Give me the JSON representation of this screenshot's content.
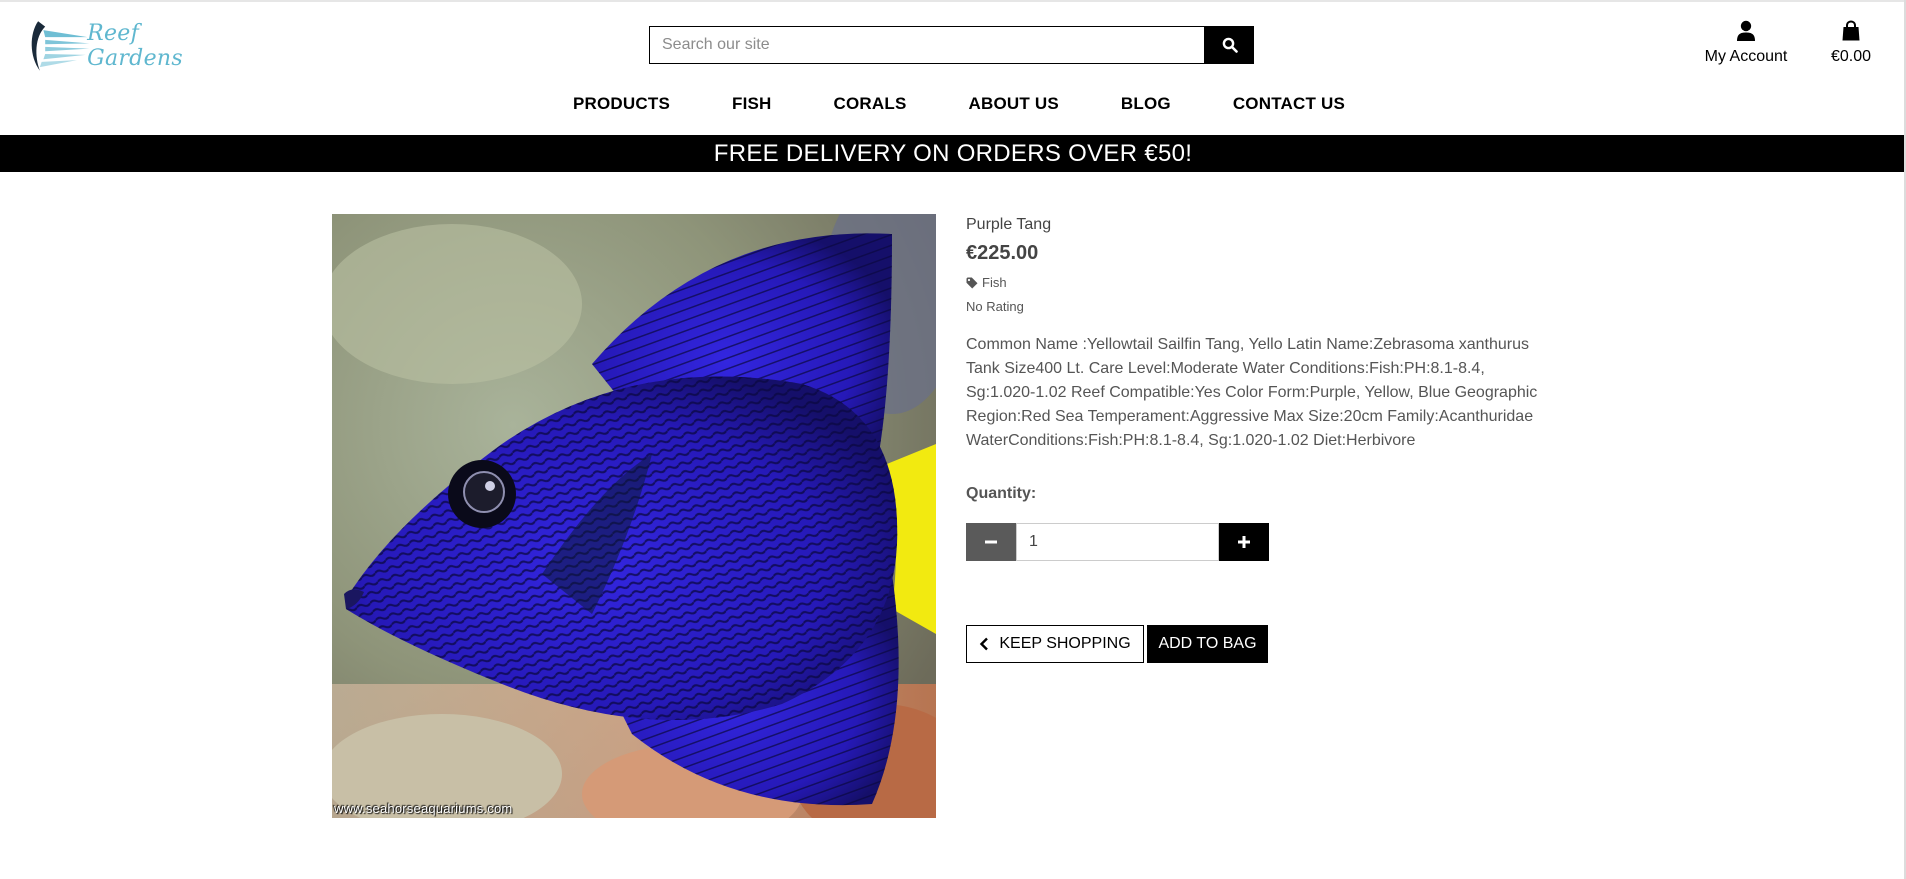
{
  "header": {
    "logo_text": "Reef Gardens",
    "search": {
      "placeholder": "Search our site",
      "value": ""
    },
    "account_label": "My Account",
    "bag_total": "€0.00"
  },
  "nav": {
    "items": [
      {
        "label": "PRODUCTS"
      },
      {
        "label": "FISH"
      },
      {
        "label": "CORALS"
      },
      {
        "label": "ABOUT US"
      },
      {
        "label": "BLOG"
      },
      {
        "label": "CONTACT US"
      }
    ]
  },
  "banner": {
    "text": "FREE DELIVERY ON ORDERS OVER €50!"
  },
  "product": {
    "image_watermark": "www.seahorseaquariums.com",
    "name": "Purple Tang",
    "price": "€225.00",
    "category": "Fish",
    "rating": "No Rating",
    "description": "Common Name :Yellowtail Sailfin Tang, Yello Latin Name:Zebrasoma xanthurus Tank Size400 Lt. Care Level:Moderate Water Conditions:Fish:PH:8.1-8.4, Sg:1.020-1.02 Reef Compatible:Yes Color Form:Purple, Yellow, Blue Geographic Region:Red Sea Temperament:Aggressive Max Size:20cm Family:Acanthuridae WaterConditions:Fish:PH:8.1-8.4, Sg:1.020-1.02 Diet:Herbivore",
    "quantity_label": "Quantity:",
    "quantity_value": "1",
    "keep_shopping_label": "KEEP SHOPPING",
    "add_to_bag_label": "ADD TO BAG"
  },
  "icons": {
    "search": "search-icon",
    "account": "user-icon",
    "bag": "shopping-bag-icon",
    "category": "tag-icon",
    "minus": "minus-icon",
    "plus": "plus-icon",
    "back": "chevron-left-icon"
  },
  "colors": {
    "brand": "#5fb7cf",
    "banner_bg": "#000000",
    "text_muted": "#555555",
    "fish_blue": "#2a1fc4",
    "fish_tail": "#f2ea10"
  }
}
